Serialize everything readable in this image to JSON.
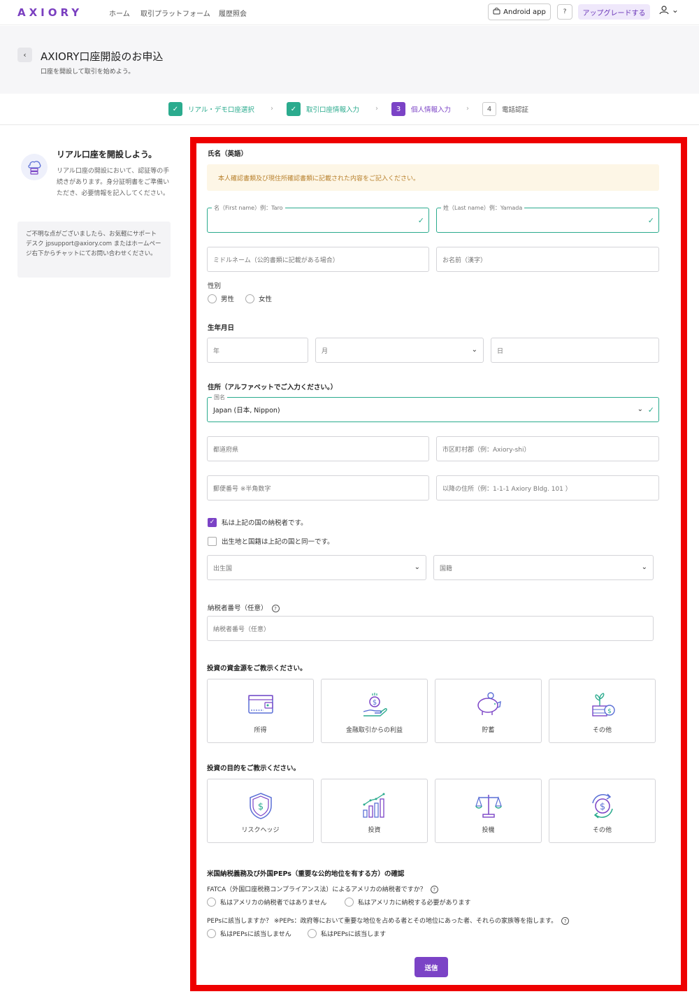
{
  "nav": {
    "logo": "AXIORY",
    "links": [
      "ホーム",
      "取引プラットフォーム",
      "履歴照会"
    ],
    "android_label": "Android app",
    "help_label": "?",
    "upgrade_label": "アップグレードする",
    "user_chevron": "⌄"
  },
  "header": {
    "back": "‹",
    "title": "AXIORY口座開設のお申込",
    "subtitle": "口座を開設して取引を始めよう。"
  },
  "stepper": [
    {
      "num": "✓",
      "label": "リアル・デモ口座選択",
      "state": "done"
    },
    {
      "num": "✓",
      "label": "取引口座情報入力",
      "state": "done"
    },
    {
      "num": "3",
      "label": "個人情報入力",
      "state": "active"
    },
    {
      "num": "4",
      "label": "電話認証",
      "state": "todo"
    }
  ],
  "sidebar": {
    "title": "リアル口座を開設しよう。",
    "text": "リアル口座の開設において、認証等の手続きがあります。身分証明書をご準備いただき、必要情報を記入してください。",
    "help": "ご不明な点がございましたら、お気軽にサポートデスク jpsupport@axiory.com またはホームページ右下からチャットにてお問い合わせください。"
  },
  "form": {
    "name_section": "氏名（英語）",
    "notice": "本人確認書類及び現住所確認書類に記載された内容をご記入ください。",
    "first_name_label": "名（First name）例：Taro",
    "last_name_label": "姓（Last name）例：Yamada",
    "middle_name_placeholder": "ミドルネーム（公的書類に記載がある場合）",
    "kanji_name_placeholder": "お名前（漢字）",
    "gender_label": "性別",
    "gender_options": [
      "男性",
      "女性"
    ],
    "birth_label": "生年月日",
    "birth_year": "年",
    "birth_month": "月",
    "birth_day": "日",
    "address_section": "住所（アルファベットでご入力ください。）",
    "country_label": "国名",
    "country_value": "Japan (日本, Nippon)",
    "prefecture_placeholder": "都道府県",
    "city_placeholder": "市区町村郡（例：Axiory-shi）",
    "zip_placeholder": "郵便番号 ※半角数字",
    "street_placeholder": "以降の住所（例：1-1-1 Axiory Bldg. 101 ）",
    "taxpayer_check": "私は上記の国の納税者です。",
    "birthplace_check": "出生地と国籍は上記の国と同一です。",
    "birth_country_placeholder": "出生国",
    "nationality_placeholder": "国籍",
    "tin_label": "納税者番号（任意）",
    "tin_placeholder": "納税者番号（任意）",
    "funds_section": "投資の資金源をご教示ください。",
    "funds_options": [
      "所得",
      "金融取引からの利益",
      "貯蓄",
      "その他"
    ],
    "purpose_section": "投資の目的をご教示ください。",
    "purpose_options": [
      "リスクヘッジ",
      "投資",
      "投機",
      "その他"
    ],
    "us_section": "米国納税義務及び外国PEPs（重要な公的地位を有する方）の確認",
    "fatca_question": "FATCA（外国口座税務コンプライアンス法）によるアメリカの納税者ですか？",
    "fatca_options": [
      "私はアメリカの納税者ではありません",
      "私はアメリカに納税する必要があります"
    ],
    "peps_question": "PEPsに該当しますか？ ※PEPs：政府等において重要な地位を占める者とその地位にあった者、それらの家族等を指します。",
    "peps_options": [
      "私はPEPsに該当しません",
      "私はPEPsに該当します"
    ],
    "submit_label": "送信"
  },
  "colors": {
    "brand": "#7b43c6",
    "success": "#2bab8e",
    "highlight_frame": "#ee0000",
    "notice_bg": "#fdf6e6"
  }
}
